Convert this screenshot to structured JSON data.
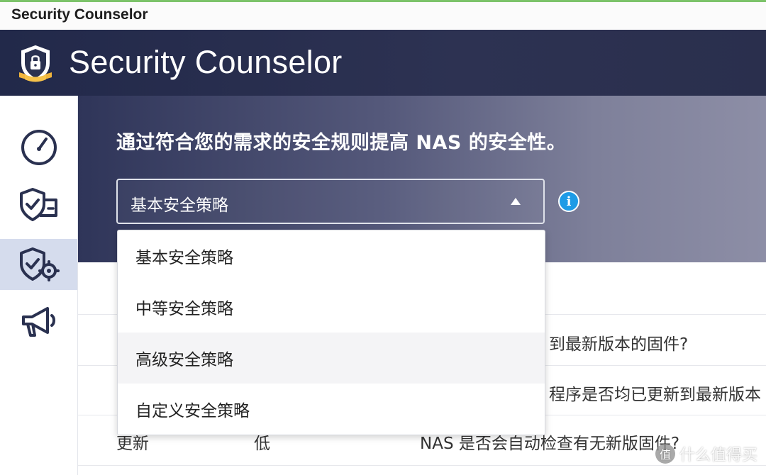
{
  "window": {
    "title": "Security Counselor"
  },
  "app": {
    "title": "Security Counselor",
    "logo_icon": "shield-lock-icon"
  },
  "sidebar": {
    "items": [
      {
        "name": "overview",
        "icon": "gauge-icon"
      },
      {
        "name": "security-checkup",
        "icon": "shield-check-card-icon"
      },
      {
        "name": "security-policy",
        "icon": "shield-gear-icon",
        "active": true
      },
      {
        "name": "notifications",
        "icon": "megaphone-icon"
      }
    ]
  },
  "hero": {
    "headline": "通过符合您的需求的安全规则提高 NAS 的安全性。",
    "policy_select": {
      "selected": "基本安全策略",
      "expanded": true,
      "options": [
        "基本安全策略",
        "中等安全策略",
        "高级安全策略",
        "自定义安全策略"
      ],
      "hovered_index": 2
    },
    "info_icon_glyph": "i"
  },
  "table": {
    "rows": [
      {
        "category": "",
        "level": "",
        "description": "到最新版本的固件?"
      },
      {
        "category": "",
        "level": "",
        "description": "程序是否均已更新到最新版本"
      },
      {
        "category": "更新",
        "level": "低",
        "description": "NAS 是否会自动检查有无新版固件?"
      }
    ]
  },
  "watermark": {
    "glyph": "值",
    "text": "什么值得买"
  },
  "colors": {
    "header_bg": "#22294a",
    "sidebar_active": "#d5dced",
    "info_blue": "#1e9be6",
    "titlebar_accent": "#7cc36a"
  }
}
